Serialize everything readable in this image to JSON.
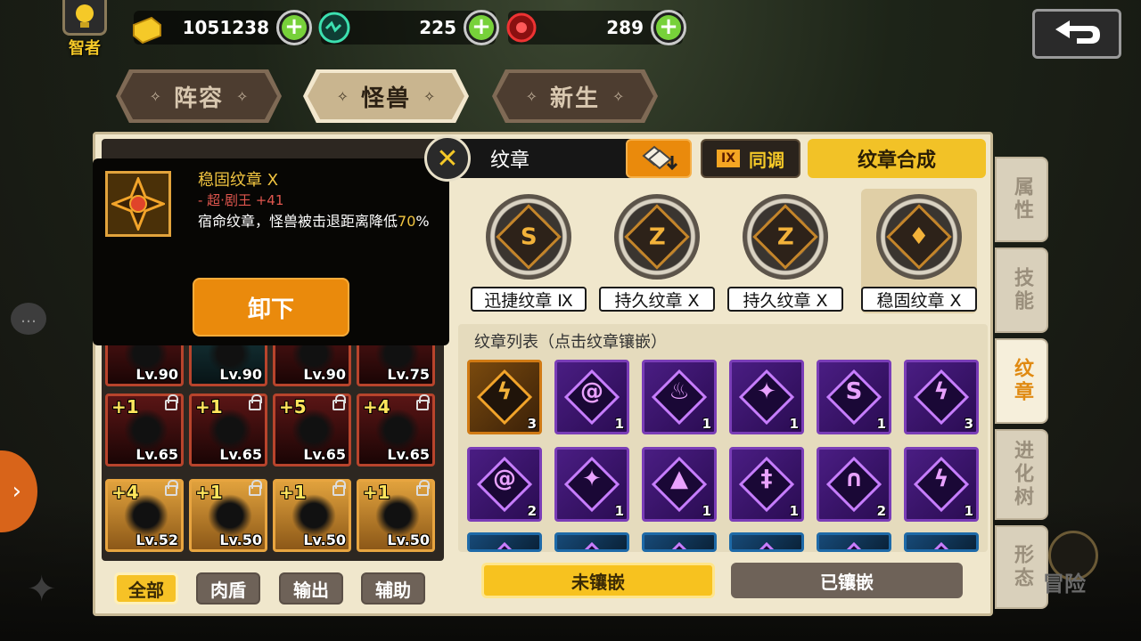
{
  "resources": {
    "wise_label": "智者",
    "gold": "1051238",
    "green": "225",
    "red": "289"
  },
  "top_tabs": [
    "阵容",
    "怪兽",
    "新生"
  ],
  "active_top_tab": 1,
  "popup": {
    "title": "稳固纹章 X",
    "subtitle": "- 超·剧王 +41",
    "desc_a": "宿命纹章，怪兽被击退距离降低",
    "desc_hl": "70",
    "desc_b": "%",
    "unload": "卸下"
  },
  "monsters": [
    {
      "plus": "",
      "lv": "Lv.90",
      "style": "red",
      "locked": false
    },
    {
      "plus": "",
      "lv": "Lv.90",
      "style": "cyan",
      "locked": false
    },
    {
      "plus": "",
      "lv": "Lv.90",
      "style": "red",
      "locked": false
    },
    {
      "plus": "",
      "lv": "Lv.75",
      "style": "red",
      "locked": false
    },
    {
      "plus": "+1",
      "lv": "Lv.65",
      "style": "red",
      "locked": true
    },
    {
      "plus": "+1",
      "lv": "Lv.65",
      "style": "red",
      "locked": true
    },
    {
      "plus": "+5",
      "lv": "Lv.65",
      "style": "red",
      "locked": true
    },
    {
      "plus": "+4",
      "lv": "Lv.65",
      "style": "red",
      "locked": true
    },
    {
      "plus": "+4",
      "lv": "Lv.52",
      "style": "gold",
      "locked": true
    },
    {
      "plus": "+1",
      "lv": "Lv.50",
      "style": "gold",
      "locked": true
    },
    {
      "plus": "+1",
      "lv": "Lv.50",
      "style": "gold",
      "locked": true
    },
    {
      "plus": "+1",
      "lv": "Lv.50",
      "style": "gold",
      "locked": true
    }
  ],
  "filters": [
    "全部",
    "肉盾",
    "输出",
    "辅助"
  ],
  "active_filter": 0,
  "header": {
    "title": "纹章",
    "same_tone_badge": "IX",
    "same_tone": "同调",
    "synthesis": "纹章合成"
  },
  "equipped": [
    {
      "label": "迅捷纹章 Ⅸ",
      "glyph": "S",
      "selected": false
    },
    {
      "label": "持久纹章 X",
      "glyph": "Z",
      "selected": false
    },
    {
      "label": "持久纹章 X",
      "glyph": "Z",
      "selected": false
    },
    {
      "label": "稳固纹章 X",
      "glyph": "♦",
      "selected": true
    }
  ],
  "list": {
    "title": "纹章列表（点击纹章镶嵌）",
    "row1": [
      {
        "glyph": "ϟ",
        "count": "3",
        "color": "orange"
      },
      {
        "glyph": "@",
        "count": "1",
        "color": "purple"
      },
      {
        "glyph": "♨",
        "count": "1",
        "color": "purple"
      },
      {
        "glyph": "✦",
        "count": "1",
        "color": "purple"
      },
      {
        "glyph": "S",
        "count": "1",
        "color": "purple"
      },
      {
        "glyph": "ϟ",
        "count": "3",
        "color": "purple"
      }
    ],
    "row2": [
      {
        "glyph": "@",
        "count": "2",
        "color": "purple"
      },
      {
        "glyph": "✦",
        "count": "1",
        "color": "purple"
      },
      {
        "glyph": "▲",
        "count": "1",
        "color": "purple"
      },
      {
        "glyph": "‡",
        "count": "1",
        "color": "purple"
      },
      {
        "glyph": "∩",
        "count": "2",
        "color": "purple"
      },
      {
        "glyph": "ϟ",
        "count": "1",
        "color": "purple"
      }
    ],
    "row3": [
      {
        "glyph": "✧",
        "count": "",
        "color": "blue"
      },
      {
        "glyph": "✧",
        "count": "",
        "color": "blue"
      },
      {
        "glyph": "✧",
        "count": "",
        "color": "blue"
      },
      {
        "glyph": "✧",
        "count": "",
        "color": "blue"
      },
      {
        "glyph": "✧",
        "count": "",
        "color": "blue"
      },
      {
        "glyph": "✧",
        "count": "",
        "color": "blue"
      }
    ]
  },
  "bottom": {
    "not_inlaid": "未镶嵌",
    "inlaid": "已镶嵌"
  },
  "side_tabs": [
    "属性",
    "技能",
    "纹章",
    "进化树",
    "形态"
  ],
  "active_side_tab": 2,
  "adventure": "冒险"
}
